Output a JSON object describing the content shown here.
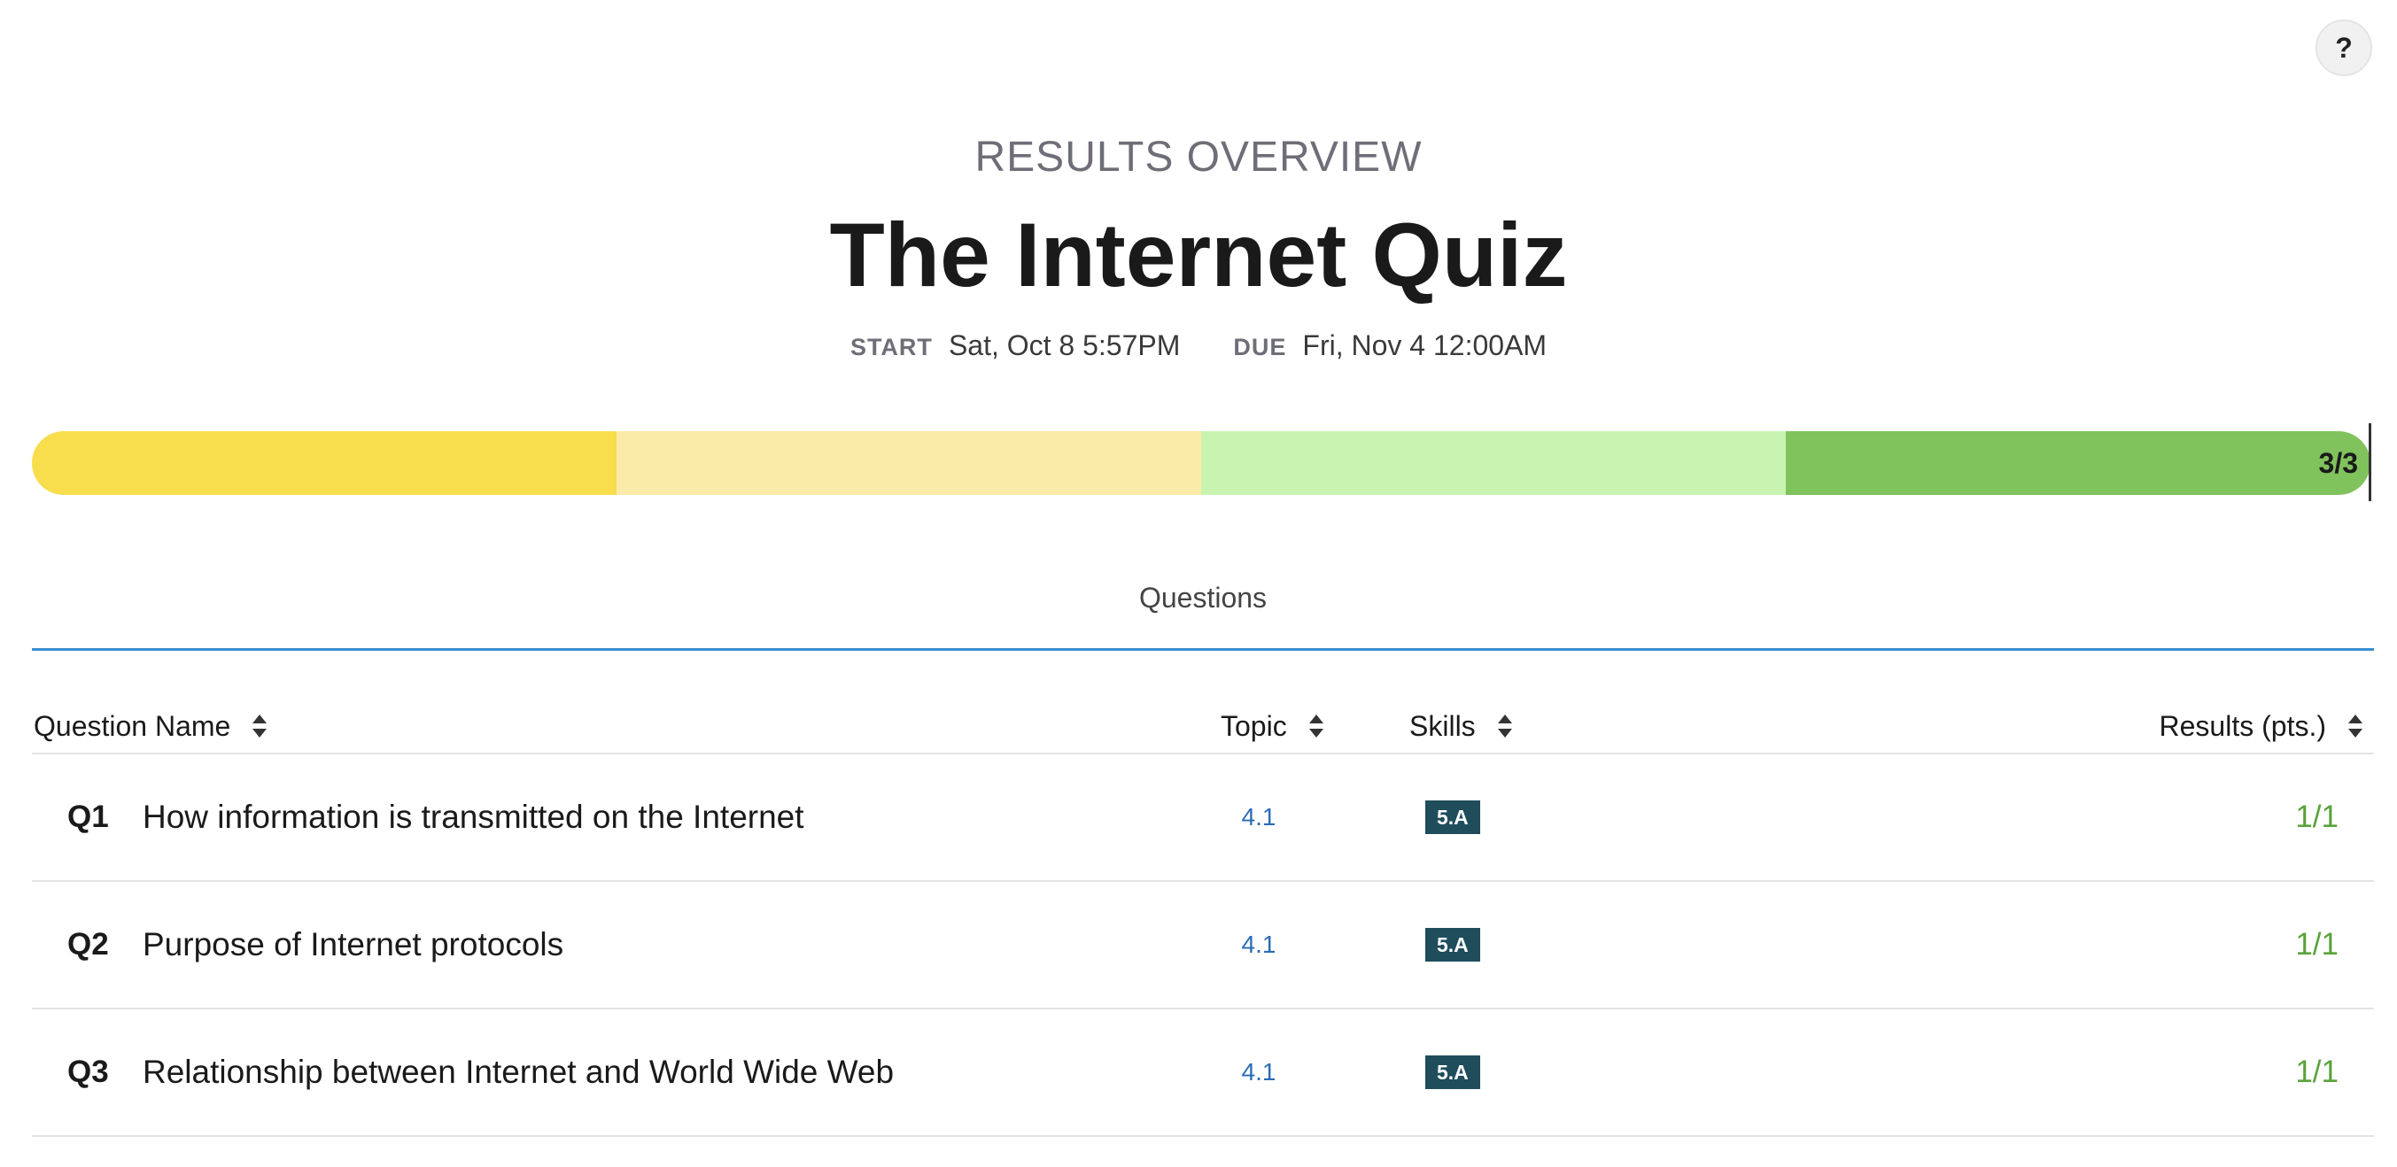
{
  "help": {
    "label": "?"
  },
  "header": {
    "eyebrow": "RESULTS OVERVIEW",
    "title": "The Internet Quiz",
    "start_label": "START",
    "start_value": "Sat, Oct 8 5:57PM",
    "due_label": "DUE",
    "due_value": "Fri, Nov 4 12:00AM"
  },
  "progress": {
    "label": "3/3",
    "score": 3,
    "max": 3,
    "segment_colors": [
      "#f8dd4c",
      "#fbeba8",
      "#c9f3b0",
      "#80c25c"
    ]
  },
  "tabs": [
    {
      "label": "Questions",
      "active": true
    }
  ],
  "table": {
    "columns": {
      "name": "Question Name",
      "topic": "Topic",
      "skills": "Skills",
      "results": "Results (pts.)"
    },
    "rows": [
      {
        "num": "Q1",
        "name": "How information is transmitted on the Internet",
        "topic": "4.1",
        "skill": "5.A",
        "result": "1/1"
      },
      {
        "num": "Q2",
        "name": "Purpose of Internet protocols",
        "topic": "4.1",
        "skill": "5.A",
        "result": "1/1"
      },
      {
        "num": "Q3",
        "name": "Relationship between Internet and World Wide Web",
        "topic": "4.1",
        "skill": "5.A",
        "result": "1/1"
      }
    ]
  },
  "colors": {
    "accent": "#3a8ed0",
    "topic_link": "#2a6bb7",
    "skill_badge": "#1f4d5c",
    "result_ok": "#5aa33a"
  }
}
